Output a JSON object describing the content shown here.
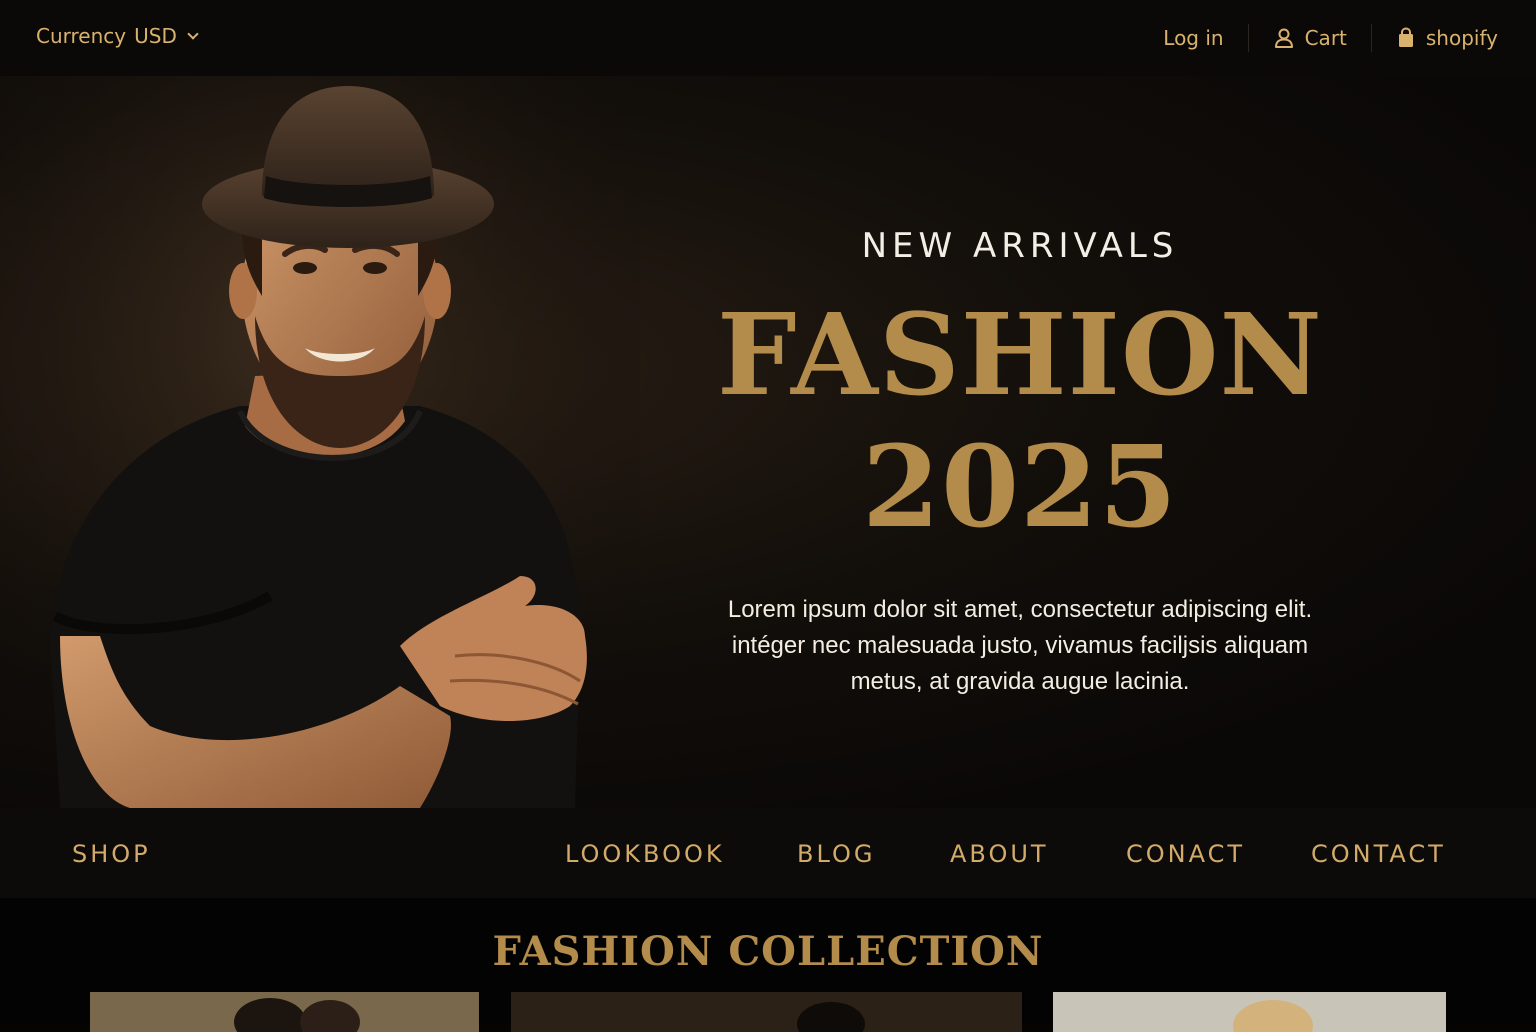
{
  "topbar": {
    "currency_label": "Currency",
    "currency_value": "USD",
    "login_label": "Log in",
    "cart_label": "Cart",
    "shop_label": "shopify"
  },
  "hero": {
    "kicker": "NEW ARRIVALS",
    "headline_line1": "FASHION",
    "headline_line2": "2025",
    "lead_line1": "Lorem ipsum dolor sit amet, consectetur adipiscing elit.",
    "lead_line2": "intéger nec malesuada justo, vivamus faciljsis aliquam",
    "lead_line3": "metus, at gravida augue lacinia."
  },
  "nav": {
    "items": [
      "SHOP",
      "LOOKBOOK",
      "BLOG",
      "ABOUT",
      "CONACT",
      "CONTACT"
    ]
  },
  "collection": {
    "title": "FASHION COLLECTION",
    "cards": [
      "collection-card-1",
      "collection-card-2",
      "collection-card-3"
    ]
  },
  "colors": {
    "gold": "#b38b4b",
    "nav_gold": "#d2aa69",
    "background": "#050403"
  },
  "icons": {
    "currency": "chevron-down-icon",
    "cart": "user-icon",
    "shop": "shopping-bag-icon"
  }
}
